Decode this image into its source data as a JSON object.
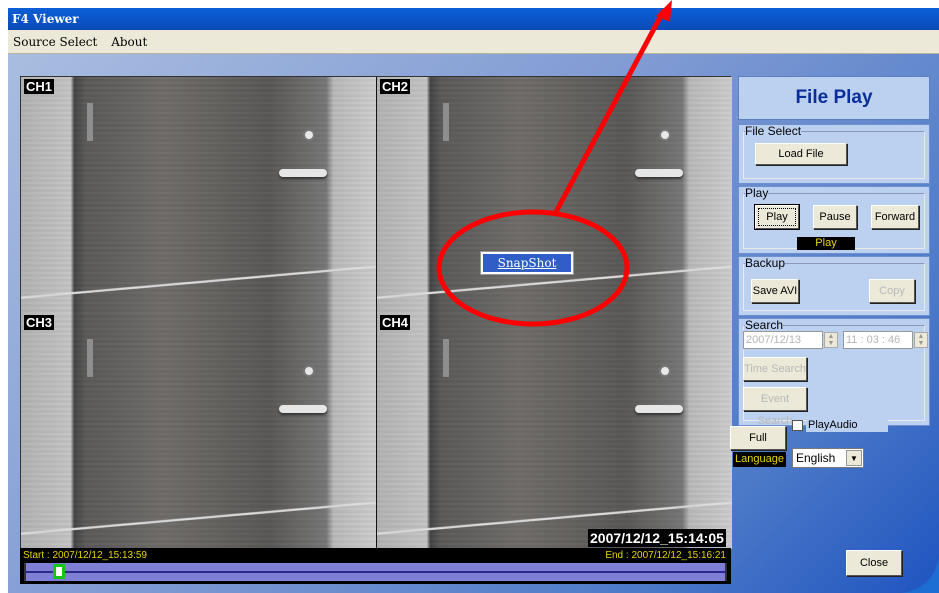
{
  "window": {
    "title": "F4 Viewer"
  },
  "menu": {
    "items": [
      "Source Select",
      "About"
    ]
  },
  "video": {
    "channels": [
      "CH1",
      "CH2",
      "CH3",
      "CH4"
    ],
    "timestamp": "2007/12/12_15:14:05"
  },
  "timeline": {
    "start": "Start : 2007/12/12_15:13:59",
    "end": "End : 2007/12/12_15:16:21",
    "position_fraction": 0.04
  },
  "context_menu": {
    "item": "SnapShot"
  },
  "panel": {
    "title": "File Play",
    "file_select": {
      "label": "File Select",
      "load_button": "Load File"
    },
    "play": {
      "label": "Play",
      "play_button": "Play",
      "pause_button": "Pause",
      "forward_button": "Forward",
      "status": "Play"
    },
    "backup": {
      "label": "Backup",
      "save_button": "Save AVI",
      "copy_button": "Copy"
    },
    "search": {
      "label": "Search",
      "date": "2007/12/13",
      "time": "11 : 03 : 46",
      "time_search_button": "Time Search",
      "event_search_button": "Event Search"
    },
    "full_screen_button": "Full Screen",
    "play_audio_label": "PlayAudio",
    "language_label": "Language",
    "language_value": "English",
    "close_button": "Close"
  },
  "colors": {
    "title_bar": "#0a4bb8",
    "panel_bg": "#bcd0ef",
    "annotation": "#ff0000"
  }
}
